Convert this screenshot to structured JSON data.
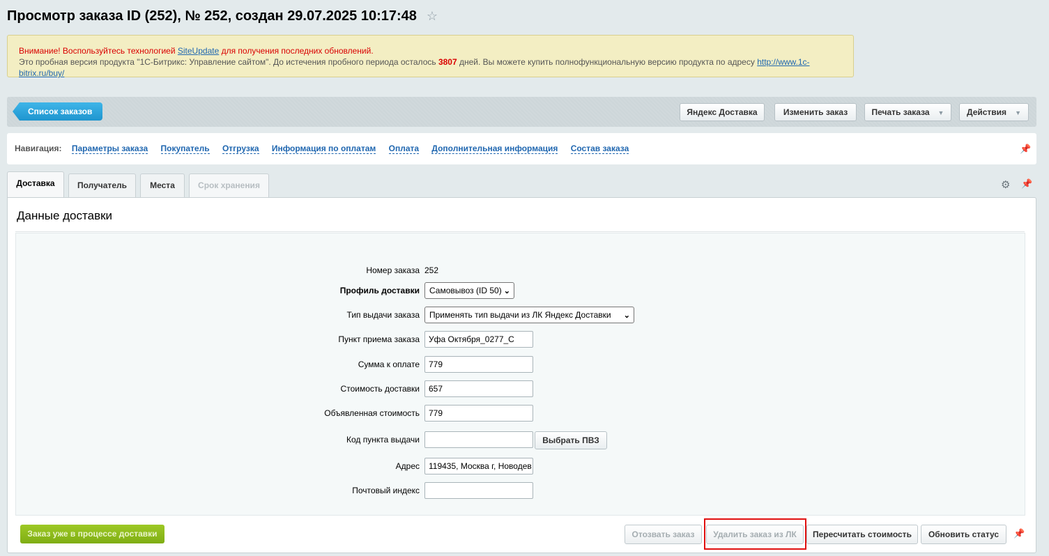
{
  "header": {
    "title": "Просмотр заказа ID (252), № 252, создан 29.07.2025 10:17:48",
    "star_icon": "☆"
  },
  "notice": {
    "line1_prefix": "Внимание! Воспользуйтесь технологией ",
    "line1_link": "SiteUpdate",
    "line1_suffix": " для получения последних обновлений.",
    "line2_prefix": "Это пробная версия продукта \"1С-Битрикс: Управление сайтом\". До истечения пробного периода осталось ",
    "line2_days": "3807",
    "line2_middle": " дней. Вы можете купить полнофункциональную версию продукта по адресу ",
    "line2_link": "http://www.1c-bitrix.ru/buy/"
  },
  "toolbar": {
    "back_label": "Список заказов",
    "yandex_label": "Яндекс Доставка",
    "edit_label": "Изменить заказ",
    "print_label": "Печать заказа",
    "actions_label": "Действия",
    "dropdown_arrow": "▼"
  },
  "nav": {
    "label": "Навигация:",
    "links": [
      "Параметры заказа",
      "Покупатель",
      "Отгрузка",
      "Информация по оплатам",
      "Оплата",
      "Дополнительная информация",
      "Состав заказа"
    ],
    "pin_icon": "📌"
  },
  "tabs": [
    "Доставка",
    "Получатель",
    "Места",
    "Срок хранения"
  ],
  "gear_icon": "⚙",
  "panel": {
    "title": "Данные доставки"
  },
  "form": {
    "order_number_label": "Номер заказа",
    "order_number_value": "252",
    "profile_label": "Профиль доставки",
    "profile_value": "Самовывоз (ID 50)",
    "issue_type_label": "Тип выдачи заказа",
    "issue_type_value": "Применять тип выдачи из ЛК Яндекс Доставки",
    "pickup_label": "Пункт приема заказа",
    "pickup_value": "Уфа Октября_0277_С",
    "amount_label": "Сумма к оплате",
    "amount_value": "779",
    "delivery_cost_label": "Стоимость доставки",
    "delivery_cost_value": "657",
    "declared_label": "Объявленная стоимость",
    "declared_value": "779",
    "point_code_label": "Код пункта выдачи",
    "point_code_value": "",
    "choose_pvz_label": "Выбрать ПВЗ",
    "address_label": "Адрес",
    "address_value": "119435, Москва г, Новодев",
    "postcode_label": "Почтовый индекс",
    "postcode_value": "",
    "select_chevron": "⌄"
  },
  "footer": {
    "in_delivery_label": "Заказ уже в процессе доставки",
    "recall_label": "Отозвать заказ",
    "delete_label": "Удалить заказ из ЛК",
    "recalc_label": "Пересчитать стоимость",
    "update_status_label": "Обновить статус"
  }
}
